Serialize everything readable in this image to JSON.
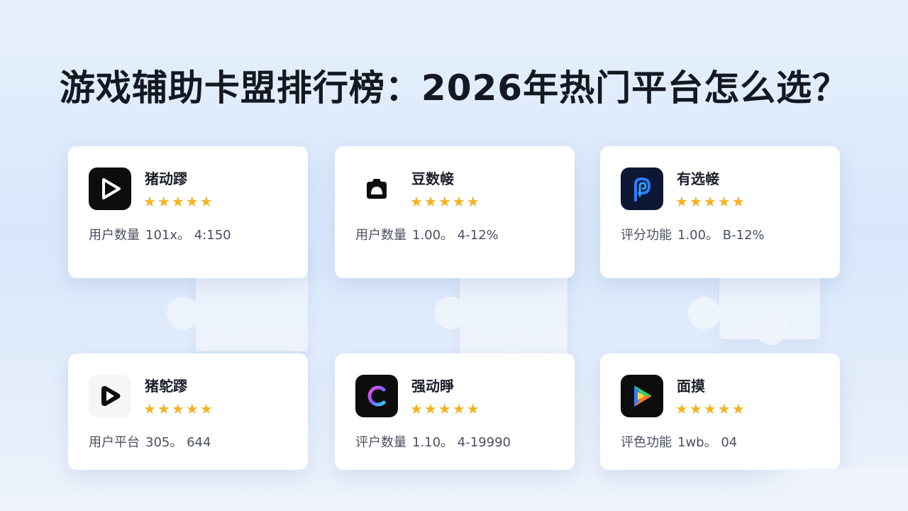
{
  "page": {
    "title": "游戏辅助卡盟排行榜：2026年热门平台怎么选？"
  },
  "cards": [
    {
      "name": "猪动蹘",
      "stars": "★★★★★",
      "rating": 5,
      "stat_label": "用户数量",
      "stat_value": "101x。 4:150",
      "icon": "play-icon",
      "icon_colors": {
        "bg": "#0d0d0d",
        "fg": "#ffffff"
      }
    },
    {
      "name": "豆数帹",
      "stars": "★★★★★",
      "rating": 5,
      "stat_label": "用户数量",
      "stat_value": "1.00。 4-12%",
      "icon": "camera-icon",
      "icon_colors": {
        "bg": "#ffffff",
        "fg": "#0d0d0d"
      }
    },
    {
      "name": "有选帹",
      "stars": "★★★★★",
      "rating": 5,
      "stat_label": "评分功能",
      "stat_value": "1.00。 B-12%",
      "icon": "p-logo-icon",
      "icon_colors": {
        "bg": "#0b1733",
        "fg": "#2f7dff"
      }
    },
    {
      "name": "猪鸵蹘",
      "stars": "★★★★★",
      "rating": 5,
      "stat_label": "用户平台",
      "stat_value": "305。 644",
      "icon": "play-circle-icon",
      "icon_colors": {
        "bg": "#f6f6f6",
        "fg": "#0d0d0d"
      }
    },
    {
      "name": "强动睜",
      "stars": "★★★★★",
      "rating": 5,
      "stat_label": "评户数量",
      "stat_value": "1.10。 4-19990",
      "icon": "c-logo-icon",
      "icon_colors": {
        "bg": "#0d0d0d",
        "fg": "#7b5cff"
      }
    },
    {
      "name": "面摸",
      "stars": "★★★★★",
      "rating": 5,
      "stat_label": "评色功能",
      "stat_value": "1wb。 04",
      "icon": "color-play-icon",
      "icon_colors": {
        "bg": "#0d0d0d",
        "fg": "#ffffff"
      }
    }
  ],
  "colors": {
    "star": "#f4b322",
    "background": "#dfeafb",
    "card": "#ffffff",
    "title": "#141821"
  }
}
